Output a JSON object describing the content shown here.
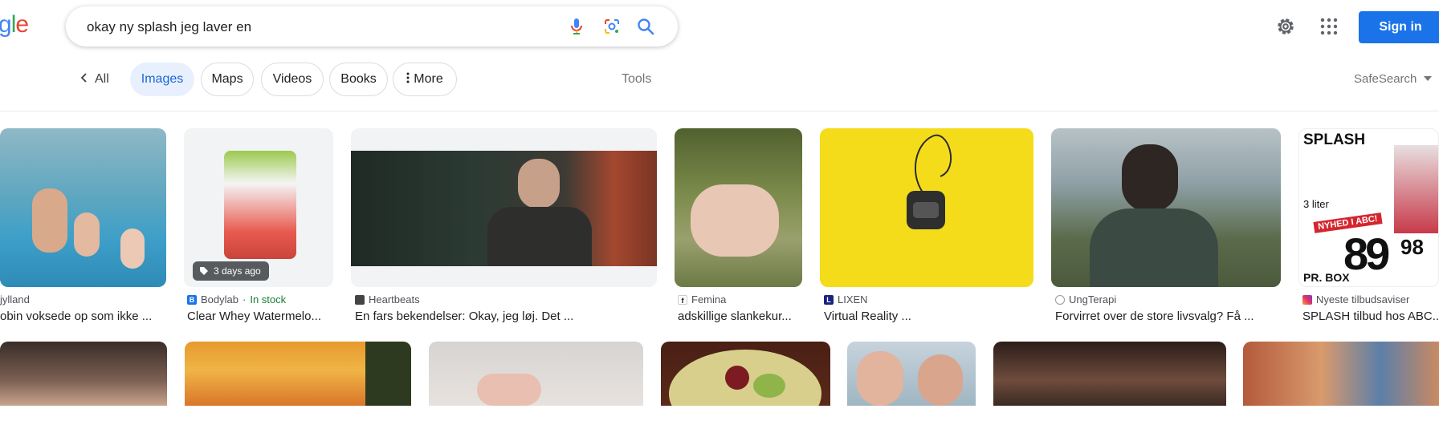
{
  "logo": {
    "part1": "g",
    "part2": "l",
    "part3": "e"
  },
  "search": {
    "query": "okay ny splash jeg laver en"
  },
  "header": {
    "signin": "Sign in"
  },
  "nav": {
    "all": "All",
    "images": "Images",
    "maps": "Maps",
    "videos": "Videos",
    "books": "Books",
    "more": "More",
    "tools": "Tools",
    "safesearch": "SafeSearch"
  },
  "results": [
    {
      "source": "jylland",
      "title": "obin voksede op som ikke ..."
    },
    {
      "source": "Bodylab",
      "stock": "In stock",
      "title": "Clear Whey Watermelo...",
      "badge": "3 days ago"
    },
    {
      "source": "Heartbeats",
      "title": "En fars bekendelser: Okay, jeg løj. Det ..."
    },
    {
      "source": "Femina",
      "title": "adskillige slankekur..."
    },
    {
      "source": "LIXEN",
      "title": "Virtual Reality ..."
    },
    {
      "source": "UngTerapi",
      "title": "Forvirret over de store livsvalg? Få ..."
    },
    {
      "source": "Nyeste tilbudsaviser",
      "title": "SPLASH tilbud hos ABC..."
    }
  ],
  "ad_image": {
    "title": "SPLASH",
    "liters": "3 liter",
    "promo": "NYHED I ABC!",
    "price_main": "89",
    "price_cents": "98",
    "unit": "PR. BOX"
  },
  "colors": {
    "accent": "#1a73e8",
    "chip_active_bg": "#e8f0fe",
    "in_stock": "#188038"
  }
}
